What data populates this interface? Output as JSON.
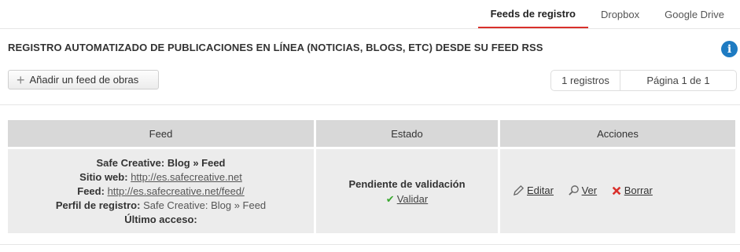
{
  "tabs": [
    {
      "label": "Feeds de registro",
      "active": true
    },
    {
      "label": "Dropbox",
      "active": false
    },
    {
      "label": "Google Drive",
      "active": false
    }
  ],
  "heading": "REGISTRO AUTOMATIZADO DE PUBLICACIONES EN LÍNEA (NOTICIAS, BLOGS, ETC) DESDE SU FEED RSS",
  "info_icon": {
    "glyph": "i",
    "name": "info-icon",
    "color": "#1e7bc2"
  },
  "add_button": {
    "icon": "plus-icon",
    "label": "Añadir un feed de obras"
  },
  "pager": {
    "count": "1 registros",
    "page": "Página 1 de 1"
  },
  "table": {
    "headers": [
      "Feed",
      "Estado",
      "Acciones"
    ],
    "rows": [
      {
        "feed_title": "Safe Creative: Blog » Feed",
        "site_label": "Sitio web:",
        "site_url": "http://es.safecreative.net",
        "feed_label": "Feed:",
        "feed_url": "http://es.safecreative.net/feed/",
        "profile_label": "Perfil de registro:",
        "profile_value": "Safe Creative: Blog » Feed",
        "last_access_label": "Último acceso:",
        "status": "Pendiente de validación",
        "validate_label": "Validar",
        "actions": {
          "edit": "Editar",
          "view": "Ver",
          "delete": "Borrar"
        }
      }
    ]
  },
  "colors": {
    "accent": "#d9302b",
    "check": "#3aa830",
    "delete": "#d9302b"
  }
}
